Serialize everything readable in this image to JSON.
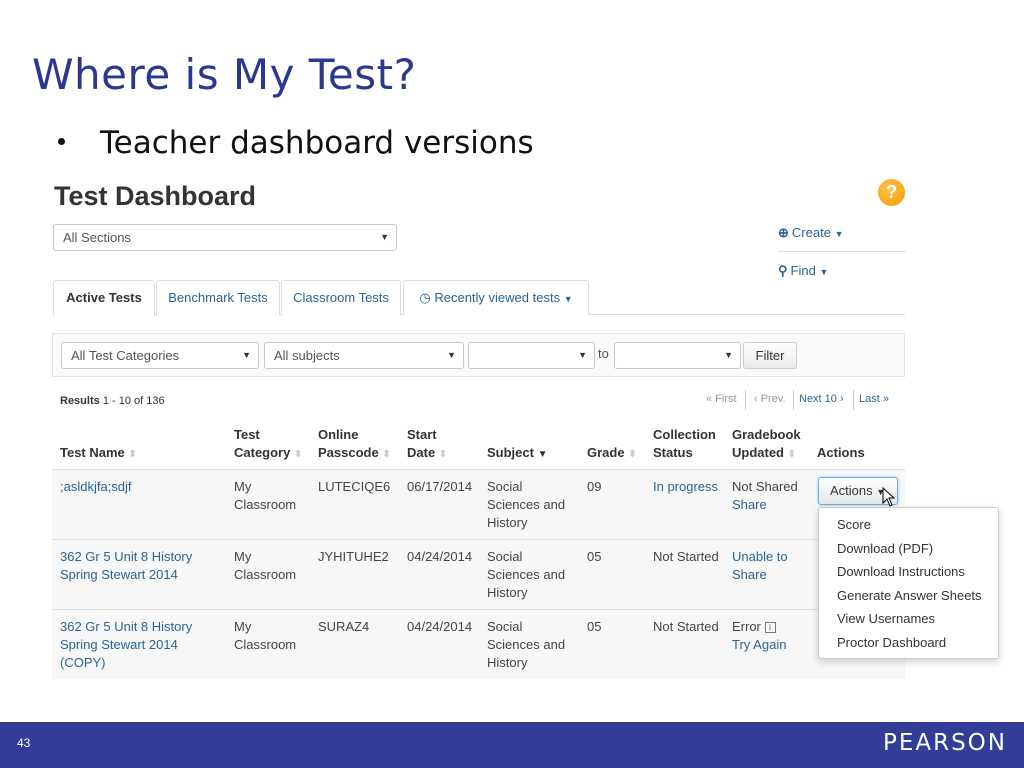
{
  "slide": {
    "title": "Where is My Test?",
    "bullet": "Teacher dashboard versions",
    "page_number": "43",
    "brand": "PEARSON"
  },
  "dashboard": {
    "title": "Test Dashboard",
    "help_icon": "?",
    "sections_select": "All Sections",
    "create_label": "Create",
    "find_label": "Find",
    "tabs": [
      "Active Tests",
      "Benchmark Tests",
      "Classroom Tests",
      "Recently viewed tests"
    ],
    "active_tab": "Active Tests",
    "filters": {
      "category": "All Test Categories",
      "subject": "All subjects",
      "date_from": "",
      "to": "to",
      "date_to": "",
      "button": "Filter"
    },
    "results": {
      "label": "Results",
      "range": "1 - 10 of 136"
    },
    "pager": {
      "first": "« First",
      "prev": "‹ Prev.",
      "next": "Next 10 ›",
      "last": "Last »"
    },
    "columns": {
      "test_name": "Test Name",
      "category_1": "Test",
      "category_2": "Category",
      "passcode_1": "Online",
      "passcode_2": "Passcode",
      "date_1": "Start",
      "date_2": "Date",
      "subject": "Subject",
      "grade": "Grade",
      "status_1": "Collection",
      "status_2": "Status",
      "gradebook_1": "Gradebook",
      "gradebook_2": "Updated",
      "actions": "Actions"
    },
    "rows": [
      {
        "name": [
          ";asldkjfa;sdjf"
        ],
        "category": [
          "My",
          "Classroom"
        ],
        "passcode": "LUTECIQE6",
        "start_date": "06/17/2014",
        "subject": [
          "Social",
          "Sciences and",
          "History"
        ],
        "grade": "09",
        "status": "In progress",
        "gradebook": [
          "Not Shared",
          "Share"
        ]
      },
      {
        "name": [
          "362 Gr 5 Unit 8 History",
          "Spring Stewart 2014"
        ],
        "category": [
          "My",
          "Classroom"
        ],
        "passcode": "JYHITUHE2",
        "start_date": "04/24/2014",
        "subject": [
          "Social",
          "Sciences and",
          "History"
        ],
        "grade": "05",
        "status": "Not Started",
        "gradebook": [
          "Unable to",
          "Share"
        ]
      },
      {
        "name": [
          "362 Gr 5 Unit 8 History",
          "Spring Stewart 2014",
          "(COPY)"
        ],
        "category": [
          "My",
          "Classroom"
        ],
        "passcode": "SURAZ4",
        "start_date": "04/24/2014",
        "subject": [
          "Social",
          "Sciences and",
          "History"
        ],
        "grade": "05",
        "status": "Not Started",
        "gradebook": [
          "Error",
          "Try Again"
        ]
      }
    ],
    "actions_button": "Actions",
    "actions_menu": [
      "Score",
      "Download (PDF)",
      "Download Instructions",
      "Generate Answer Sheets",
      "View Usernames",
      "Proctor Dashboard"
    ]
  },
  "colors": {
    "title": "#2a3890",
    "link": "#2a6496",
    "footer": "#313d96",
    "help": "#f39c00"
  }
}
